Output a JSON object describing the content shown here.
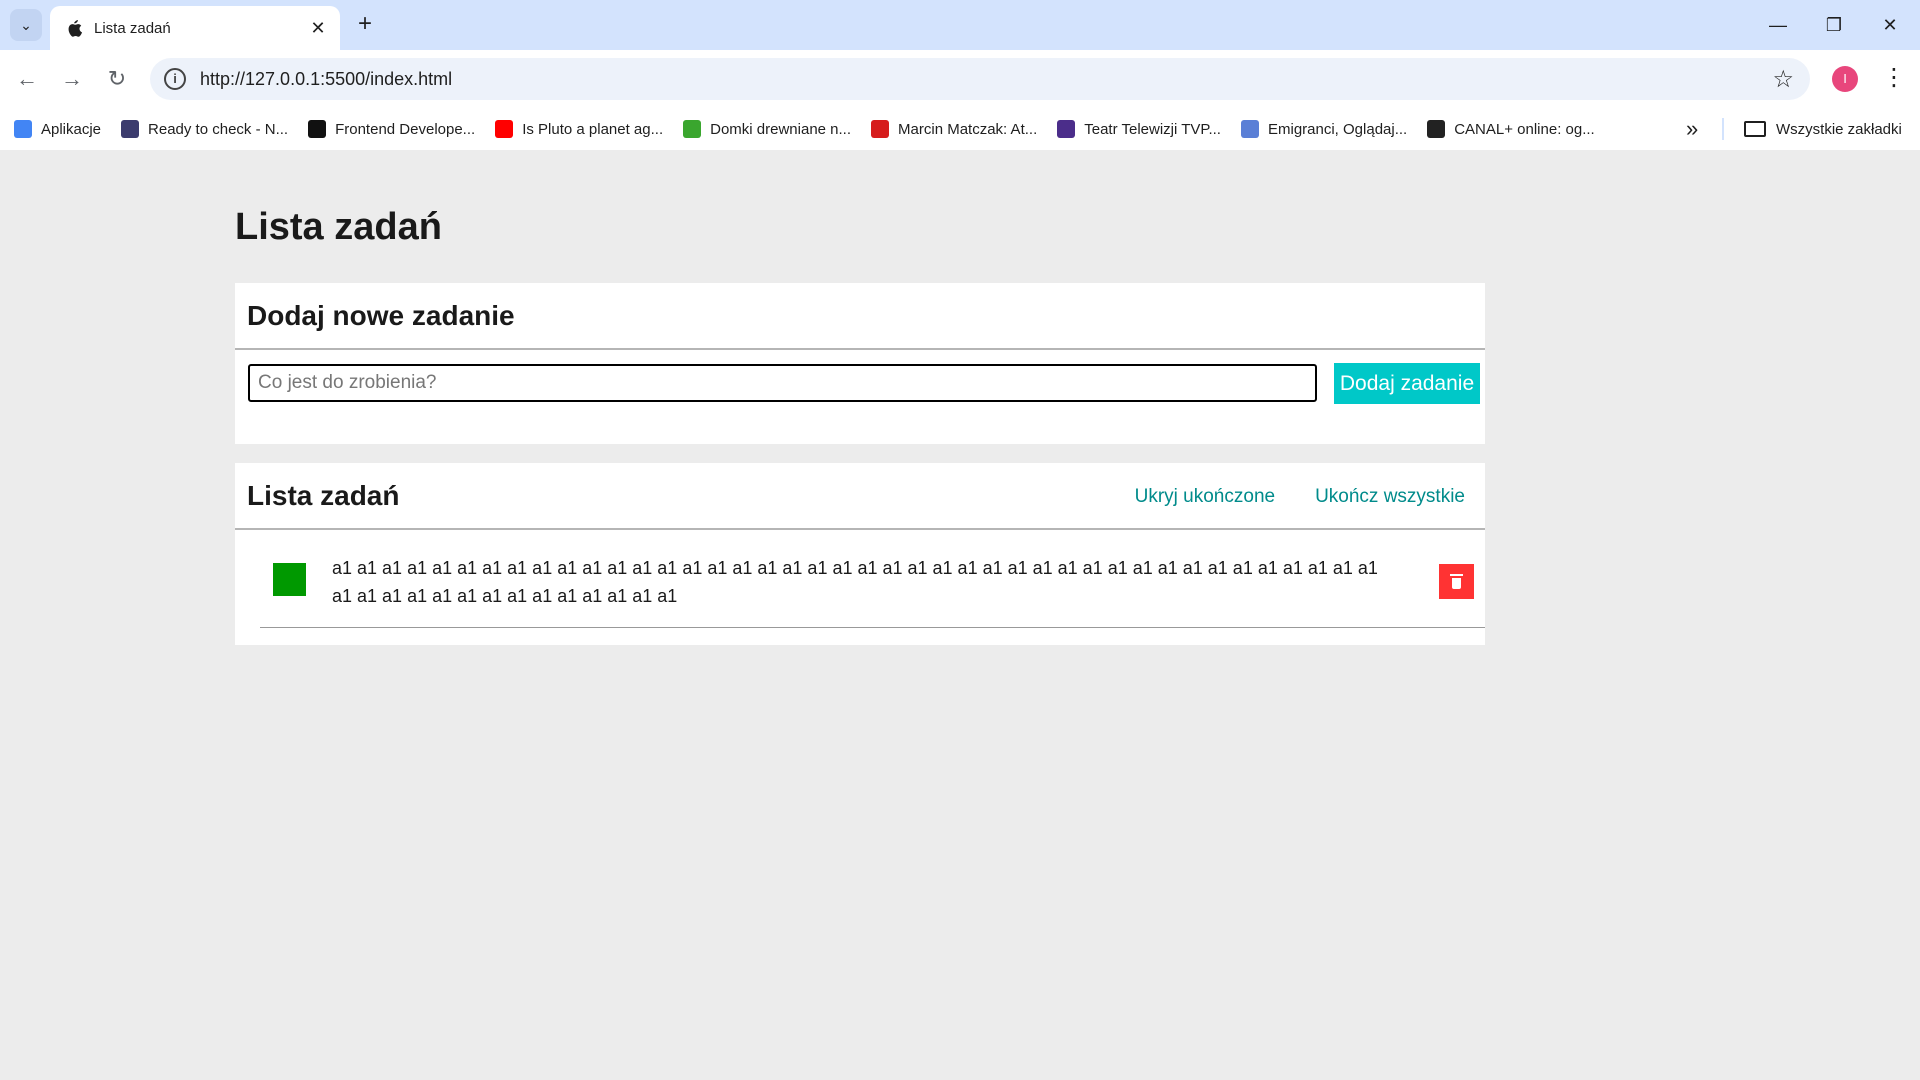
{
  "browser": {
    "tab_title": "Lista zadań",
    "new_tab_symbol": "+",
    "url": "http://127.0.0.1:5500/index.html",
    "avatar_letter": "I",
    "bookmarks": [
      {
        "label": "Aplikacje",
        "icon": "apps-grid-icon",
        "color": "#4285f4"
      },
      {
        "label": "Ready to check - N...",
        "icon": "mask-icon",
        "color": "#3b3b6d"
      },
      {
        "label": "Frontend Develope...",
        "icon": "frontend-icon",
        "color": "#111111"
      },
      {
        "label": "Is Pluto a planet ag...",
        "icon": "youtube-icon",
        "color": "#ff0000"
      },
      {
        "label": "Domki drewniane n...",
        "icon": "s-logo-icon",
        "color": "#3aa62e"
      },
      {
        "label": "Marcin Matczak: At...",
        "icon": "red-bookmark-icon",
        "color": "#d61c1c"
      },
      {
        "label": "Teatr Telewizji TVP...",
        "icon": "tvp-icon",
        "color": "#4b2d8a"
      },
      {
        "label": "Emigranci, Oglądaj...",
        "icon": "vod-icon",
        "color": "#5a7fd6"
      },
      {
        "label": "CANAL+ online: og...",
        "icon": "canal-plus-icon",
        "color": "#222222"
      }
    ],
    "all_bookmarks_label": "Wszystkie zakładki"
  },
  "page": {
    "title": "Lista zadań",
    "add_section": {
      "heading": "Dodaj nowe zadanie",
      "input_placeholder": "Co jest do zrobienia?",
      "input_value": "",
      "button_label": "Dodaj zadanie"
    },
    "list_section": {
      "heading": "Lista zadań",
      "hide_done_label": "Ukryj ukończone",
      "complete_all_label": "Ukończ wszystkie",
      "tasks": [
        {
          "text": "a1 a1 a1 a1 a1 a1 a1 a1 a1 a1 a1 a1 a1 a1 a1 a1 a1 a1 a1 a1 a1 a1 a1 a1 a1 a1 a1 a1 a1 a1 a1 a1 a1 a1 a1 a1 a1 a1 a1 a1 a1 a1 a1 a1 a1 a1 a1 a1 a1 a1 a1 a1 a1 a1 a1 a1",
          "done": true
        }
      ]
    }
  },
  "colors": {
    "accent": "#00c8c8",
    "link": "#008b8b",
    "done_check": "#009900",
    "delete": "#ff3333"
  }
}
